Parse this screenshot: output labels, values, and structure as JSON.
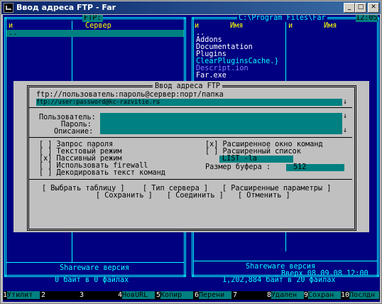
{
  "window": {
    "title": "Ввод адреса FTP - Far"
  },
  "left_panel": {
    "title": "FTP:",
    "col_n": "и",
    "col_server": "Сервер",
    "up_item": "..",
    "shareware": "Shareware версия",
    "stats": "0 байт в 0 файлах"
  },
  "right_panel": {
    "path": "C:\\Program Files\\Far",
    "clock": "12:05",
    "col_n1": "и",
    "col_name1": "Имя",
    "col_n2": "и",
    "col_name2": "Имя",
    "items": [
      {
        "name": "..",
        "style": "wh"
      },
      {
        "name": "Addons",
        "style": "wh"
      },
      {
        "name": "Documentation",
        "style": "wh"
      },
      {
        "name": "Plugins",
        "style": "wh"
      },
      {
        "name": "ClearPluginsCache.}",
        "style": "cy"
      },
      {
        "name": "Descript.ion",
        "style": "grey"
      },
      {
        "name": "Far.exe",
        "style": "wh"
      }
    ],
    "shareware": "Shareware версия",
    "info": "Вверх 08.09.08 12:00",
    "stats": "1,202,884 байт в 20 файлах"
  },
  "dialog": {
    "title": "Ввод адреса FTP",
    "address_label": "ftp://пользователь:пароль@сервер:порт/папка",
    "address_value": "ftp://user:password@kc-razvitie.ru",
    "user_label": "Пользователь:",
    "password_label": "Пароль:",
    "description_label": "Описание:",
    "options_left": [
      {
        "mark": "[ ]",
        "label": "Запрос пароля"
      },
      {
        "mark": "[ ]",
        "label": "Текстовый режим"
      },
      {
        "mark": "[x]",
        "label": "Пассивный режим"
      },
      {
        "mark": "[ ]",
        "label": "Использовать firewall"
      },
      {
        "mark": "[ ]",
        "label": "Декодировать текст команд"
      }
    ],
    "options_right": [
      {
        "mark": "[x]",
        "label": "Расширенное окно команд"
      },
      {
        "mark": "[ ]",
        "label": "Расширенный список"
      }
    ],
    "list_cmd": "LIST -la",
    "buffer_label": "Размер буфера :",
    "buffer_value": "512",
    "buttons_row1": [
      "[ Выбрать таблицу ]",
      "[ Тип сервера ]",
      "[ Расширенные параметры ]"
    ],
    "buttons_row2": [
      "[ Сохранить ]",
      "[ Соединить ]",
      "[ Отменить ]"
    ]
  },
  "fkeys": [
    {
      "num": "1",
      "label": "Утилит"
    },
    {
      "num": "2",
      "label": ""
    },
    {
      "num": "3",
      "label": ""
    },
    {
      "num": "4",
      "label": "НовURL"
    },
    {
      "num": "5",
      "label": "Копир"
    },
    {
      "num": "6",
      "label": "Перени"
    },
    {
      "num": "7",
      "label": ""
    },
    {
      "num": "8",
      "label": "Удален"
    },
    {
      "num": "9",
      "label": "Сохран"
    },
    {
      "num": "10",
      "label": "Послдн"
    }
  ],
  "colors": {
    "console_bg": "#000080",
    "frame": "#00ffff",
    "selection": "#008080",
    "dialog_bg": "#c0c0c0"
  }
}
